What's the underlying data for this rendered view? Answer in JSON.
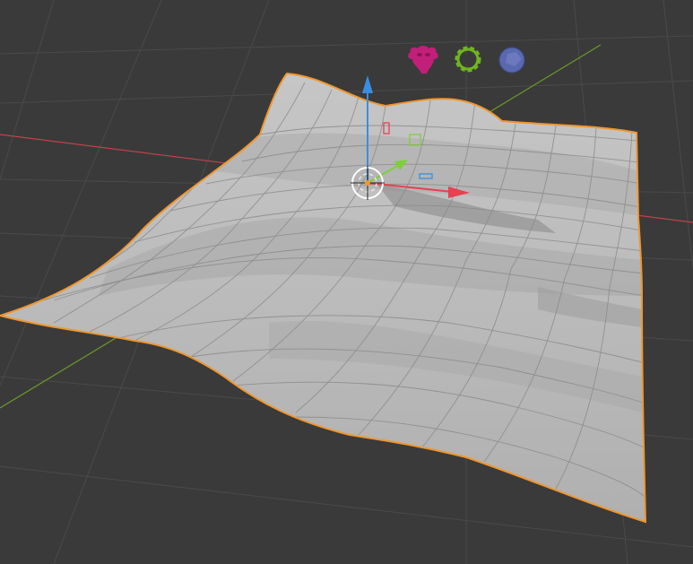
{
  "viewport": {
    "background_color": "#3a3a3a",
    "grid_color": "#4a4a4a",
    "x_axis_color": "#c0424d",
    "y_axis_color": "#6a9a2a",
    "z_axis_color": "#3b8de0"
  },
  "mesh": {
    "surface_color": "#b8b8b8",
    "wire_color": "#8a8a8a",
    "selection_outline_color": "#f0962e"
  },
  "gizmo": {
    "x_arrow_color": "#e8404f",
    "y_arrow_color": "#7fcf3a",
    "z_arrow_color": "#3b8de0",
    "origin_color": "#f0962e"
  },
  "overlay_icons": [
    {
      "icon": "monkey-icon",
      "color": "#c21f7a"
    },
    {
      "icon": "gear-icon",
      "color": "#6fb51f"
    },
    {
      "icon": "sphere-icon",
      "color": "#5a68b0"
    }
  ]
}
